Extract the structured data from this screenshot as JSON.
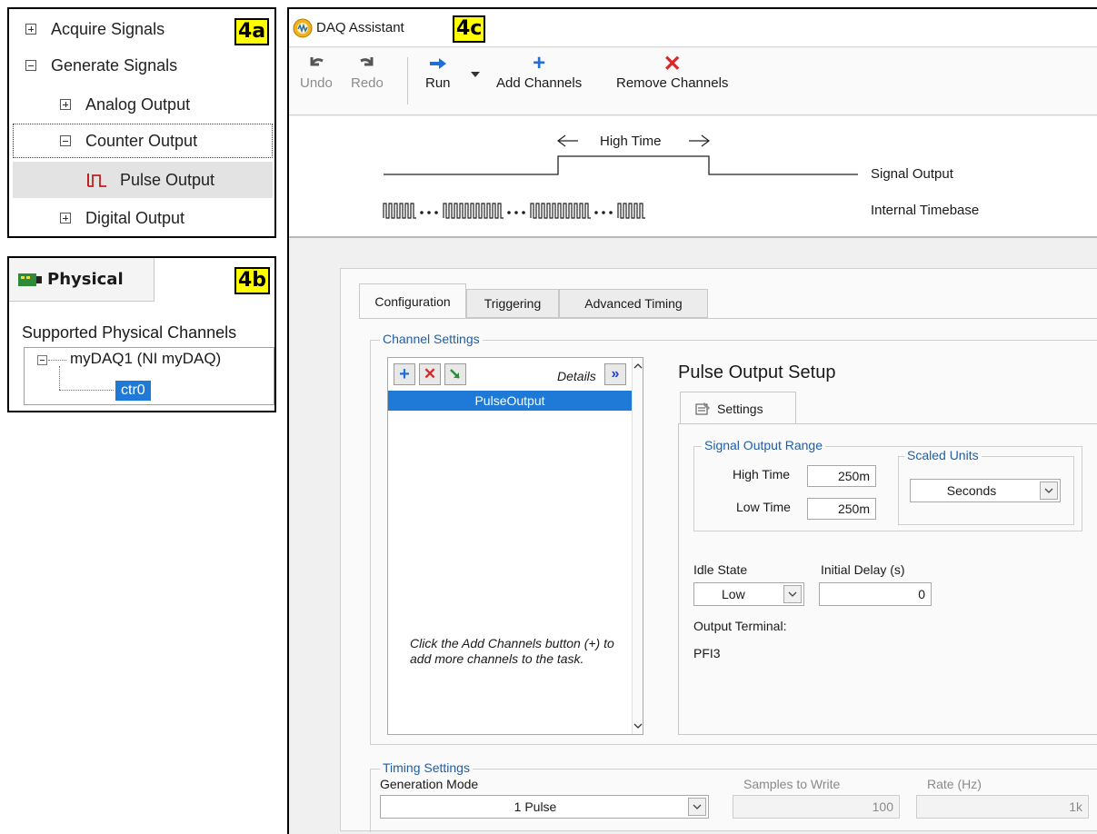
{
  "panel_a": {
    "callout": "4a",
    "items": [
      {
        "label": "Acquire Signals",
        "state": "collapsed"
      },
      {
        "label": "Generate Signals",
        "state": "expanded"
      },
      {
        "label": "Analog Output",
        "state": "collapsed"
      },
      {
        "label": "Counter Output",
        "state": "expanded"
      },
      {
        "label": "Pulse Output",
        "state": "leaf",
        "icon": "pulse-icon"
      },
      {
        "label": "Digital Output",
        "state": "collapsed"
      }
    ]
  },
  "panel_b": {
    "callout": "4b",
    "tab_label": "Physical",
    "heading": "Supported Physical Channels",
    "device": "myDAQ1  (NI myDAQ)",
    "channel": "ctr0"
  },
  "panel_c": {
    "callout": "4c",
    "window_title": "DAQ Assistant",
    "toolbar": {
      "undo": "Undo",
      "redo": "Redo",
      "run": "Run",
      "add_channels": "Add Channels",
      "remove_channels": "Remove Channels"
    },
    "diagram": {
      "high_time": "High Time",
      "signal_output": "Signal Output",
      "internal_timebase": "Internal Timebase"
    },
    "tabs": [
      "Configuration",
      "Triggering",
      "Advanced Timing"
    ],
    "channel_settings": {
      "title": "Channel Settings",
      "details_label": "Details",
      "channels": [
        "PulseOutput"
      ],
      "hint": "Click the Add Channels button (+) to add more channels to the task."
    },
    "pulse_setup": {
      "title": "Pulse Output Setup",
      "settings_tab": "Settings",
      "signal_output_range": {
        "title": "Signal Output Range",
        "high_time_label": "High Time",
        "high_time_value": "250m",
        "low_time_label": "Low Time",
        "low_time_value": "250m"
      },
      "scaled_units": {
        "title": "Scaled Units",
        "value": "Seconds"
      },
      "idle_state_label": "Idle State",
      "idle_state_value": "Low",
      "initial_delay_label": "Initial Delay (s)",
      "initial_delay_value": "0",
      "output_terminal_label": "Output Terminal:",
      "output_terminal_value": "PFI3"
    },
    "timing_settings": {
      "title": "Timing Settings",
      "generation_mode_label": "Generation Mode",
      "generation_mode_value": "1 Pulse",
      "samples_label": "Samples to Write",
      "samples_value": "100",
      "rate_label": "Rate (Hz)",
      "rate_value": "1k"
    },
    "colors": {
      "accent_blue": "#1f5fa8",
      "selection_blue": "#1e7ad6",
      "remove_red": "#d62a2a",
      "callout_yellow": "#ffff00"
    }
  }
}
